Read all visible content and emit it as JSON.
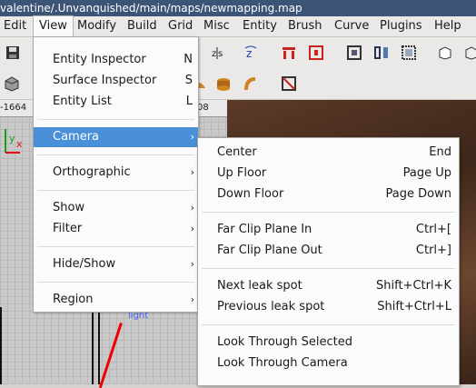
{
  "window": {
    "title": "valentine/.Unvanquished/main/maps/newmapping.map"
  },
  "menubar": [
    "Edit",
    "View",
    "Modify",
    "Build",
    "Grid",
    "Misc",
    "Entity",
    "Brush",
    "Curve",
    "Plugins",
    "Help"
  ],
  "grid_header": {
    "left": "-1664",
    "right": "08"
  },
  "grid_axis": {
    "y": "y",
    "x": "x"
  },
  "grid_entity_label": "light",
  "view_menu": {
    "items": [
      {
        "label": "Entity Inspector",
        "accel": "N"
      },
      {
        "label": "Surface Inspector",
        "accel": "S"
      },
      {
        "label": "Entity List",
        "accel": "L"
      },
      {
        "label": "Camera",
        "submenu": true
      },
      {
        "label": "Orthographic",
        "submenu": true
      },
      {
        "label": "Show",
        "submenu": true
      },
      {
        "label": "Filter",
        "submenu": true
      },
      {
        "label": "Hide/Show",
        "submenu": true
      },
      {
        "label": "Region",
        "submenu": true
      }
    ]
  },
  "camera_menu": {
    "items": [
      {
        "label": "Center",
        "accel": "End"
      },
      {
        "label": "Up Floor",
        "accel": "Page Up"
      },
      {
        "label": "Down Floor",
        "accel": "Page Down"
      },
      {
        "label": "Far Clip Plane In",
        "accel": "Ctrl+["
      },
      {
        "label": "Far Clip Plane Out",
        "accel": "Ctrl+]"
      },
      {
        "label": "Next leak spot",
        "accel": "Shift+Ctrl+K"
      },
      {
        "label": "Previous leak spot",
        "accel": "Shift+Ctrl+L"
      },
      {
        "label": "Look Through Selected",
        "accel": ""
      },
      {
        "label": "Look Through Camera",
        "accel": ""
      }
    ]
  },
  "toolbar_icons": [
    "save-icon",
    "x-axis-flip-icon",
    "z-axis-icon",
    "z-rotate-icon",
    "brush-prefab-icon",
    "brush-prefab2-icon",
    "clipper-icon",
    "texture-lock-icon",
    "grid-select-icon",
    "cube-icon",
    "cube2-icon",
    "cube-open-icon",
    "patch-icon",
    "bevel-icon",
    "cone-icon",
    "arch-icon",
    "no-select-icon"
  ],
  "submenu_arrow": "›"
}
